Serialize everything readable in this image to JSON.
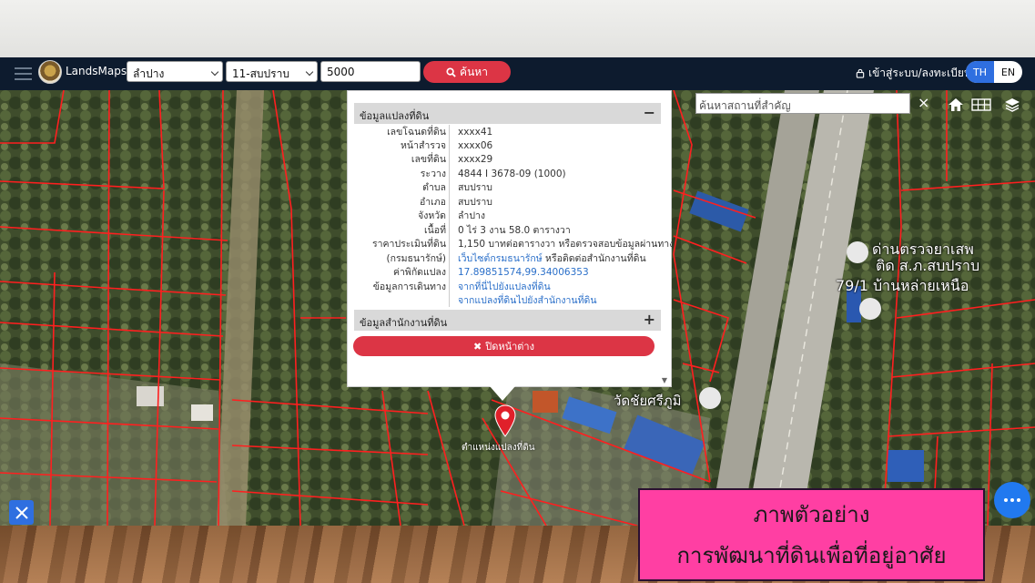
{
  "navbar": {
    "logo_text": "LandsMaps",
    "province_select": "ลำปาง",
    "district_select": "11-สบปราบ",
    "parcel_input": "5000",
    "search_button": "ค้นหา",
    "login_link": "เข้าสู่ระบบ/ลงทะเบียน",
    "lang_th": "TH",
    "lang_en": "EN"
  },
  "map_tools": {
    "place_search_placeholder": "ค้นหาสถานที่สำคัญ",
    "close_glyph": "×"
  },
  "popup": {
    "section1_title": "ข้อมูลแปลงที่ดิน",
    "section1_sign": "−",
    "rows": [
      {
        "label": "เลขโฉนดที่ดิน",
        "value": "xxxx41"
      },
      {
        "label": "หน้าสำรวจ",
        "value": "xxxx06"
      },
      {
        "label": "เลขที่ดิน",
        "value": "xxxx29"
      },
      {
        "label": "ระวาง",
        "value": "4844 I 3678-09 (1000)"
      },
      {
        "label": "ตำบล",
        "value": "สบปราบ"
      },
      {
        "label": "อำเภอ",
        "value": "สบปราบ"
      },
      {
        "label": "จังหวัด",
        "value": "ลำปาง"
      },
      {
        "label": "เนื้อที่",
        "value": "0 ไร่ 3 งาน 58.0 ตารางวา"
      },
      {
        "label": "ราคาประเมินที่ดิน",
        "value": "1,150 บาทต่อตารางวา หรือตรวจสอบข้อมูลผ่านทาง"
      },
      {
        "label": "(กรมธนารักษ์)",
        "value": "เว็บไซต์กรมธนารักษ์",
        "value_suffix": " หรือติดต่อสำนักงานที่ดิน"
      },
      {
        "label": "ค่าพิกัดแปลง",
        "value": "17.89851574,99.34006353"
      },
      {
        "label": "ข้อมูลการเดินทาง",
        "value": "จากที่นี่ไปยังแปลงที่ดิน"
      },
      {
        "label": "",
        "value": "จากแปลงที่ดินไปยังสำนักงานที่ดิน"
      }
    ],
    "section2_title": "ข้อมูลสำนักงานที่ดิน",
    "section2_sign": "+",
    "close_button": "ปิดหน้าต่าง"
  },
  "map_labels": {
    "pin_label": "ตำแหน่งแปลงที่ดิน",
    "checkpoint_line1": "ด่านตรวจยาเสพ",
    "checkpoint_line2": "ติด ส.ภ.สบปราบ",
    "village": "79/1 บ้านหล่ายเหนือ",
    "temple": "วัดชัยศรีภูมิ"
  },
  "overlay": {
    "line1": "ภาพตัวอย่าง",
    "line2": "การพัฒนาที่ดินเพื่อที่อยู่อาศัย"
  },
  "colors": {
    "navbar_bg": "#0d1b2e",
    "accent_red": "#dc3545",
    "accent_blue": "#2f6fe0",
    "overlay_pink": "#ff3fa3",
    "parcel_line": "#ff1f1f"
  }
}
